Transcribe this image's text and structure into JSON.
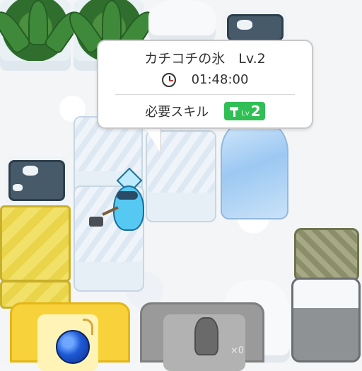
{
  "popup": {
    "title": "カチコチの氷　Lv.2",
    "time_icon": "clock-icon",
    "time": "01:48:00",
    "skill_label": "必要スキル",
    "skill_icon": "hammer-icon",
    "skill_level_prefix": "Lv",
    "skill_level": "2",
    "badge_color": "#2fbf54"
  },
  "actions": {
    "bomb_icon": "bomb-icon",
    "locked_count": "×0"
  },
  "colors": {
    "bomb_slot": "#f7d23a",
    "locked_slot": "#9a9a9a",
    "character": "#56c9f2"
  }
}
